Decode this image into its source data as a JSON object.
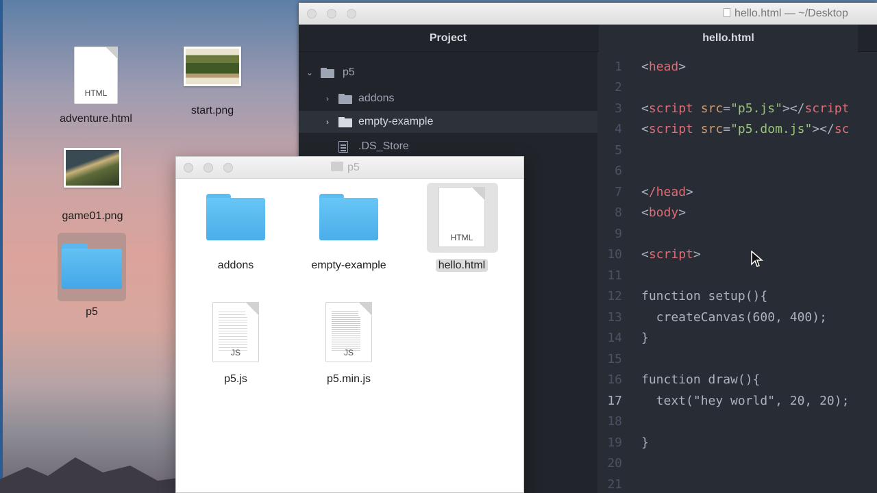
{
  "desktop": {
    "icons": [
      {
        "label": "adventure.html",
        "type": "HTML"
      },
      {
        "label": "start.png"
      },
      {
        "label": "game01.png"
      },
      {
        "label": "p5"
      }
    ]
  },
  "editor": {
    "window_title": "hello.html — ~/Desktop",
    "tree_title": "Project",
    "tree": [
      {
        "label": "p5",
        "expanded": true
      },
      {
        "label": "addons"
      },
      {
        "label": "empty-example",
        "selected": true
      },
      {
        "label": ".DS_Store"
      }
    ],
    "active_tab": "hello.html",
    "lines": [
      {
        "n": "1"
      },
      {
        "n": "2"
      },
      {
        "n": "3"
      },
      {
        "n": "4"
      },
      {
        "n": "5"
      },
      {
        "n": "6"
      },
      {
        "n": "7"
      },
      {
        "n": "8"
      },
      {
        "n": "9"
      },
      {
        "n": "10"
      },
      {
        "n": "11"
      },
      {
        "n": "12"
      },
      {
        "n": "13"
      },
      {
        "n": "14"
      },
      {
        "n": "15"
      },
      {
        "n": "16"
      },
      {
        "n": "17"
      },
      {
        "n": "18"
      },
      {
        "n": "19"
      },
      {
        "n": "20"
      },
      {
        "n": "21"
      }
    ],
    "code": {
      "l1_tag": "head",
      "l3_tag": "script",
      "l3_attr": "src",
      "l3_val": "\"p5.js\"",
      "l3_close": "script",
      "l4_tag": "script",
      "l4_attr": "src",
      "l4_val": "\"p5.dom.js\"",
      "l4_close": "sc",
      "l7_tag": "/head",
      "l8_tag": "body",
      "l10_tag": "script",
      "l12": "function setup(){",
      "l13": "  createCanvas(600, 400);",
      "l14": "}",
      "l16": "function draw(){",
      "l17": "  text(\"hey world\", 20, 20);",
      "l19": "}"
    }
  },
  "finder": {
    "title": "p5",
    "items": [
      {
        "label": "addons",
        "kind": "folder"
      },
      {
        "label": "empty-example",
        "kind": "folder"
      },
      {
        "label": "hello.html",
        "kind": "HTML",
        "selected": true
      },
      {
        "label": "p5.js",
        "kind": "JS"
      },
      {
        "label": "p5.min.js",
        "kind": "JS"
      }
    ]
  },
  "colors": {
    "editor_bg": "#282c34",
    "tree_bg": "#21252b",
    "tag": "#e06c75",
    "attr": "#d19a66",
    "string": "#98c379",
    "folder_blue": "#4aaee9"
  }
}
